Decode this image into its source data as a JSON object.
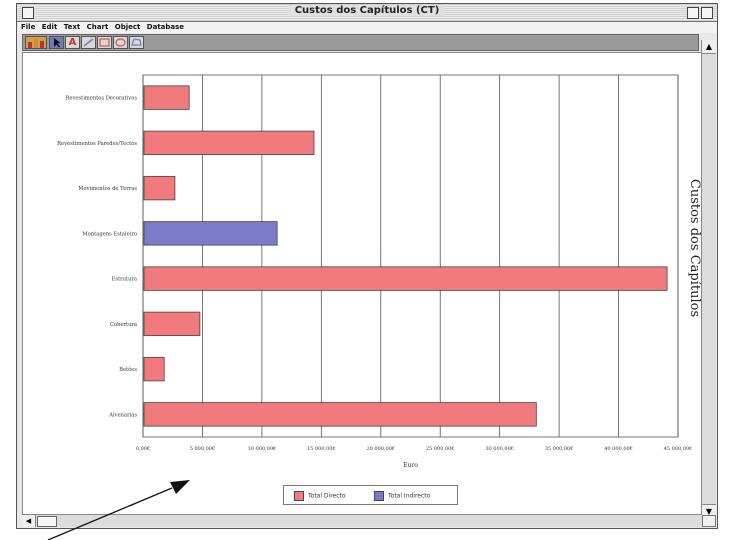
{
  "window": {
    "title": "Custos dos Capítulos (CT)"
  },
  "menu": [
    "File",
    "Edit",
    "Text",
    "Chart",
    "Object",
    "Database"
  ],
  "toolbar": {
    "tools": [
      {
        "icon": "bar-chart-icon"
      },
      {
        "icon": "arrow-pointer-icon"
      },
      {
        "icon": "text-tool-icon"
      },
      {
        "icon": "line-tool-icon"
      },
      {
        "icon": "rectangle-tool-icon"
      },
      {
        "icon": "ellipse-tool-icon"
      },
      {
        "icon": "polygon-tool-icon"
      }
    ]
  },
  "colors": {
    "direct": "#f07a7d",
    "indirect": "#7b7cc9"
  },
  "chart_data": {
    "type": "bar",
    "orientation": "horizontal",
    "title": "Custos dos Capítulos",
    "xlabel": "Euro",
    "xlim": [
      0,
      45000
    ],
    "categories": [
      "Revestimentos Decorativos",
      "Revestimentos Paredes/Tectos",
      "Movimentos de Terras",
      "Montagens Estaleiro",
      "Estrutura",
      "Cobertura",
      "Betões",
      "Alvenarias"
    ],
    "series": [
      {
        "name": "Total Directo",
        "values": [
          3800,
          null,
          2600,
          null,
          44000,
          4700,
          1700,
          33000
        ]
      },
      {
        "name": "Total Indirecto",
        "values": [
          null,
          null,
          null,
          11200,
          null,
          null,
          null,
          null
        ]
      }
    ],
    "extra_direct": {
      "category": "Revestimentos Paredes/Tectos",
      "value": 14300
    },
    "tick_labels": [
      "0,00€",
      "5 000,00€",
      "10 000,00€",
      "15 000,00€",
      "20 000,00€",
      "25 000,00€",
      "30 000,00€",
      "35 000,00€",
      "40 000,00€",
      "45 000,00€"
    ],
    "grid": true,
    "legend": "bottom"
  }
}
